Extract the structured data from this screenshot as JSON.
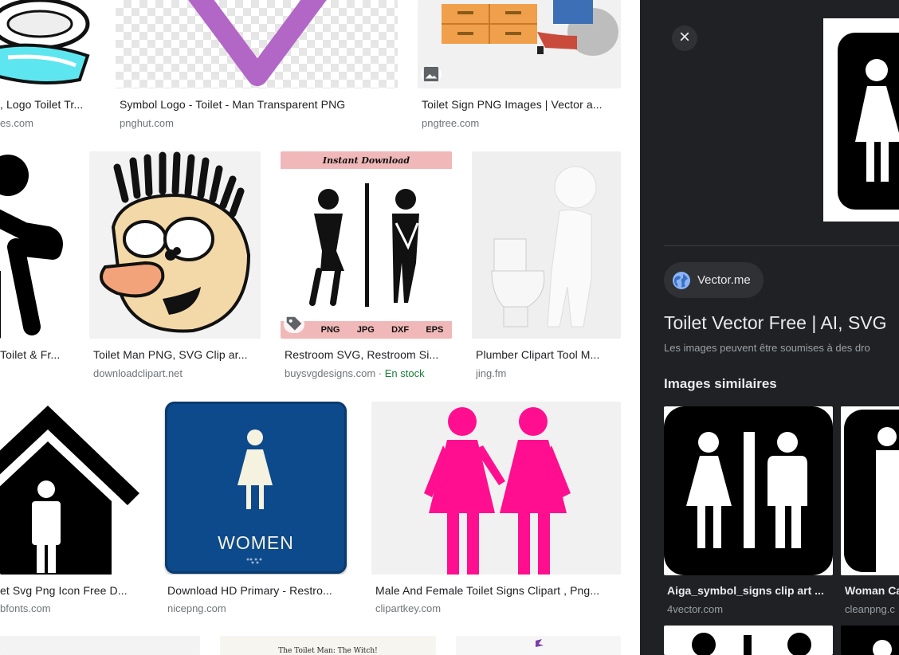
{
  "results": [
    {
      "title": "Symbol Logo Toilet Transparent PNG",
      "visible_title": ", Logo Toilet Tr...",
      "source": "es.com"
    },
    {
      "title": "Symbol Logo - Toilet - Man Transparent PNG",
      "source": "pnghut.com"
    },
    {
      "title": "Toilet Sign PNG Images | Vector a...",
      "source": "pngtree.com"
    },
    {
      "title": "Toilet & Fr...",
      "source": ""
    },
    {
      "title": "Toilet Man PNG, SVG Clip ar...",
      "source": "downloadclipart.net"
    },
    {
      "title": "Restroom SVG, Restroom Si...",
      "source": "buysvgdesigns.com",
      "stock": "En stock",
      "banner": "Instant Download",
      "formats": [
        "PNG",
        "JPG",
        "DXF",
        "EPS"
      ]
    },
    {
      "title": "Plumber Clipart Tool M...",
      "source": "jing.fm"
    },
    {
      "title": "et Svg Png Icon Free D...",
      "source": "bfonts.com"
    },
    {
      "title": "Download HD Primary - Restro...",
      "source": "nicepng.com",
      "sign_text": "WOMEN"
    },
    {
      "title": "Male And Female Toilet Signs Clipart , Png...",
      "source": "clipartkey.com"
    },
    {
      "banner": "The Toilet Man: The Witch!"
    }
  ],
  "panel": {
    "close_label": "×",
    "source_name": "Vector.me",
    "title": "Toilet Vector Free | AI, SVG",
    "note": "Les images peuvent être soumises à des dro",
    "similar_heading": "Images similaires",
    "similar": [
      {
        "title": "Aiga_symbol_signs clip art ...",
        "source": "4vector.com"
      },
      {
        "title": "Woman Ca",
        "source": "cleanpng.c"
      }
    ]
  },
  "colors": {
    "panel_bg": "#202124",
    "chip_bg": "#303134",
    "pink": "#ff0f8f",
    "purple": "#b266c6",
    "sign_blue": "#0d4a8b",
    "stock_green": "#188038"
  },
  "icons": [
    "image-icon",
    "tag-icon",
    "globe-icon",
    "close-icon"
  ]
}
